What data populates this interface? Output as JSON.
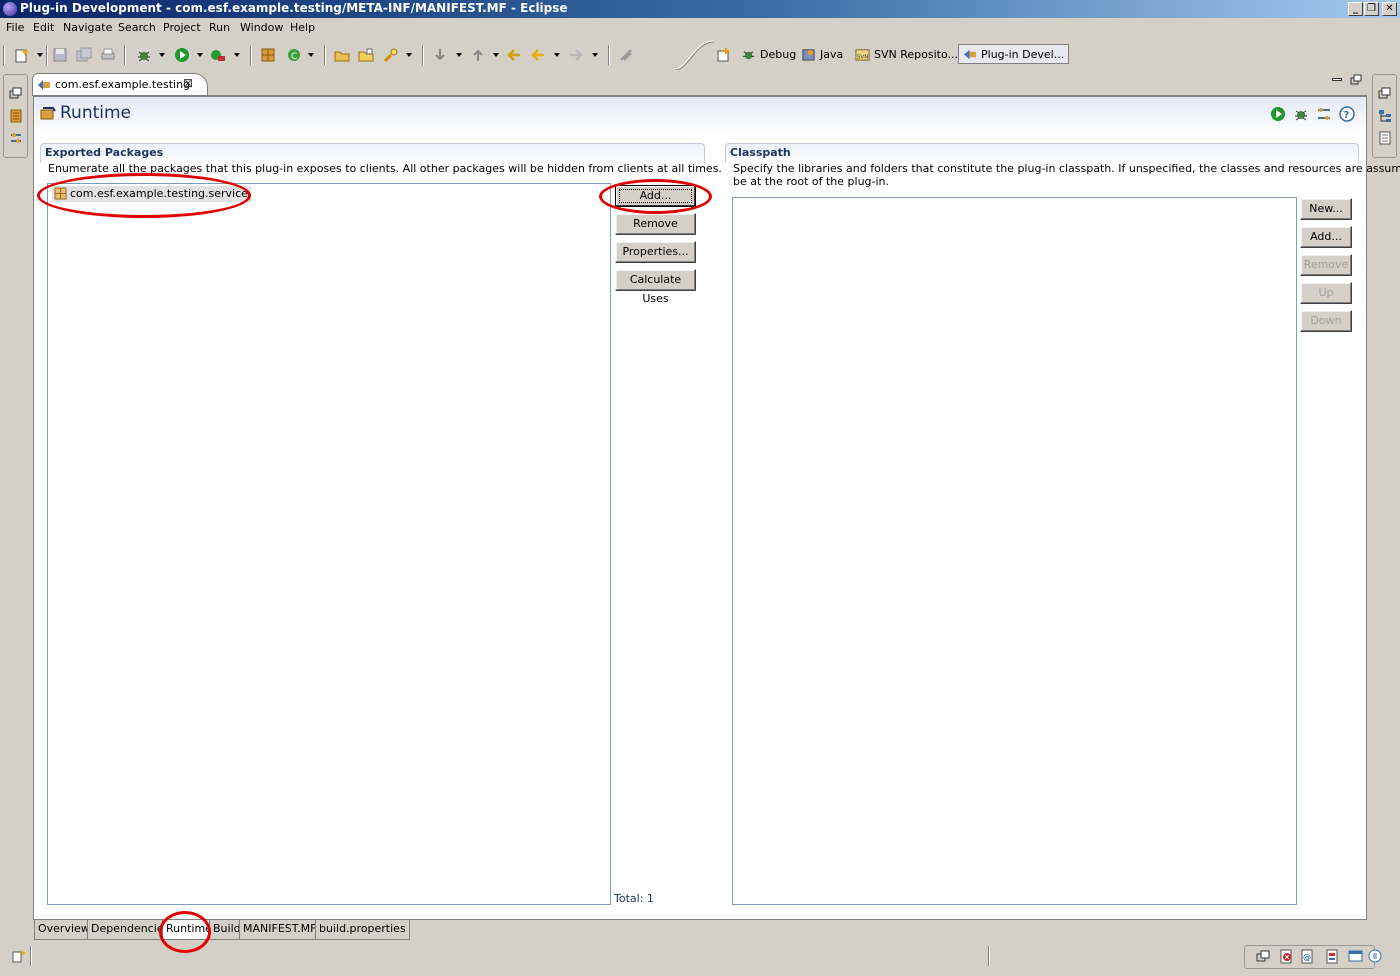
{
  "window": {
    "title": "Plug-in Development - com.esf.example.testing/META-INF/MANIFEST.MF - Eclipse"
  },
  "menu": [
    "File",
    "Edit",
    "Navigate",
    "Search",
    "Project",
    "Run",
    "Window",
    "Help"
  ],
  "perspectives": [
    {
      "label": "Debug",
      "icon": "debug-bug-icon"
    },
    {
      "label": "Java",
      "icon": "java-perspective-icon"
    },
    {
      "label": "SVN Reposito...",
      "icon": "svn-repository-icon"
    },
    {
      "label": "Plug-in Devel...",
      "icon": "plugin-development-icon"
    }
  ],
  "editor": {
    "tab_label": "com.esf.example.testing",
    "form_title": "Runtime"
  },
  "exported_packages": {
    "title": "Exported Packages",
    "description": "Enumerate all the packages that this plug-in exposes to clients.  All other packages will be hidden from clients at all times.",
    "items": [
      "com.esf.example.testing.service"
    ],
    "buttons": {
      "add": "Add...",
      "remove": "Remove",
      "properties": "Properties...",
      "calculate_uses": "Calculate Uses"
    },
    "total": "Total: 1"
  },
  "classpath": {
    "title": "Classpath",
    "description_line1": "Specify the libraries and folders that constitute the plug-in classpath.  If unspecified, the classes and resources are assumed to",
    "description_line2": "be at the root of the plug-in.",
    "buttons": {
      "new": "New...",
      "add": "Add...",
      "remove": "Remove",
      "up": "Up",
      "down": "Down"
    }
  },
  "page_tabs": [
    "Overview",
    "Dependencies",
    "Runtime",
    "Build",
    "MANIFEST.MF",
    "build.properties"
  ],
  "active_page_tab": "Runtime",
  "colors": {
    "annotation_red": "#e00000",
    "form_title_blue": "#1d3164",
    "section_title_blue": "#1c3562",
    "title_bar_start": "#0a246a"
  }
}
